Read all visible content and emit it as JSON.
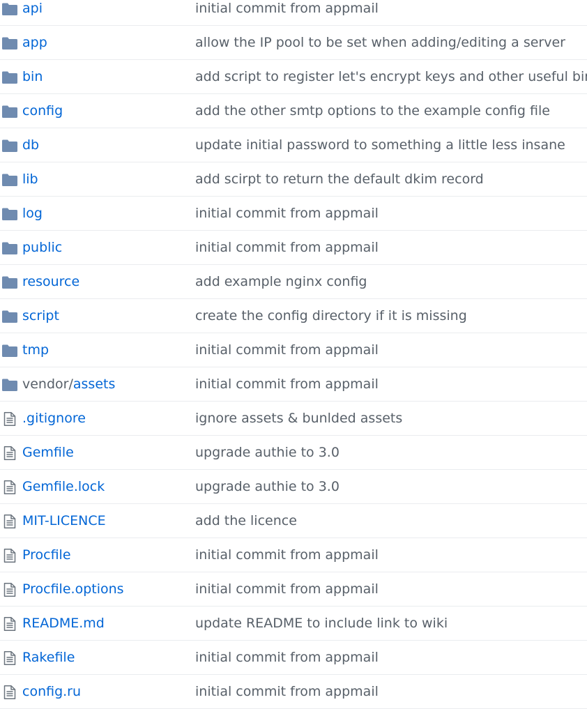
{
  "colors": {
    "link": "#0366d6",
    "muted": "#586069",
    "folder_icon": "#79b8ff",
    "file_icon": "#6a737d",
    "divider": "#eaecef"
  },
  "files": [
    {
      "type": "folder",
      "icon": "folder-icon",
      "prefix": "",
      "name": "api",
      "message": "initial commit from appmail"
    },
    {
      "type": "folder",
      "icon": "folder-icon",
      "prefix": "",
      "name": "app",
      "message": "allow the IP pool to be set when adding/editing a server"
    },
    {
      "type": "folder",
      "icon": "folder-icon",
      "prefix": "",
      "name": "bin",
      "message": "add script to register let's encrypt keys and other useful bin/p"
    },
    {
      "type": "folder",
      "icon": "folder-icon",
      "prefix": "",
      "name": "config",
      "message": "add the other smtp options to the example config file"
    },
    {
      "type": "folder",
      "icon": "folder-icon",
      "prefix": "",
      "name": "db",
      "message": "update initial password to something a little less insane"
    },
    {
      "type": "folder",
      "icon": "folder-icon",
      "prefix": "",
      "name": "lib",
      "message": "add scirpt to return the default dkim record"
    },
    {
      "type": "folder",
      "icon": "folder-icon",
      "prefix": "",
      "name": "log",
      "message": "initial commit from appmail"
    },
    {
      "type": "folder",
      "icon": "folder-icon",
      "prefix": "",
      "name": "public",
      "message": "initial commit from appmail"
    },
    {
      "type": "folder",
      "icon": "folder-icon",
      "prefix": "",
      "name": "resource",
      "message": "add example nginx config"
    },
    {
      "type": "folder",
      "icon": "folder-icon",
      "prefix": "",
      "name": "script",
      "message": "create the config directory if it is missing"
    },
    {
      "type": "folder",
      "icon": "folder-icon",
      "prefix": "",
      "name": "tmp",
      "message": "initial commit from appmail"
    },
    {
      "type": "folder",
      "icon": "folder-icon",
      "prefix": "vendor/",
      "name": "assets",
      "message": "initial commit from appmail"
    },
    {
      "type": "file",
      "icon": "file-icon",
      "prefix": "",
      "name": ".gitignore",
      "message": "ignore assets & bunlded assets"
    },
    {
      "type": "file",
      "icon": "file-icon",
      "prefix": "",
      "name": "Gemfile",
      "message": "upgrade authie to 3.0"
    },
    {
      "type": "file",
      "icon": "file-icon",
      "prefix": "",
      "name": "Gemfile.lock",
      "message": "upgrade authie to 3.0"
    },
    {
      "type": "file",
      "icon": "file-icon",
      "prefix": "",
      "name": "MIT-LICENCE",
      "message": "add the licence"
    },
    {
      "type": "file",
      "icon": "file-icon",
      "prefix": "",
      "name": "Procfile",
      "message": "initial commit from appmail"
    },
    {
      "type": "file",
      "icon": "file-icon",
      "prefix": "",
      "name": "Procfile.options",
      "message": "initial commit from appmail"
    },
    {
      "type": "file",
      "icon": "file-icon",
      "prefix": "",
      "name": "README.md",
      "message": "update README to include link to wiki"
    },
    {
      "type": "file",
      "icon": "file-icon",
      "prefix": "",
      "name": "Rakefile",
      "message": "initial commit from appmail"
    },
    {
      "type": "file",
      "icon": "file-icon",
      "prefix": "",
      "name": "config.ru",
      "message": "initial commit from appmail"
    }
  ]
}
